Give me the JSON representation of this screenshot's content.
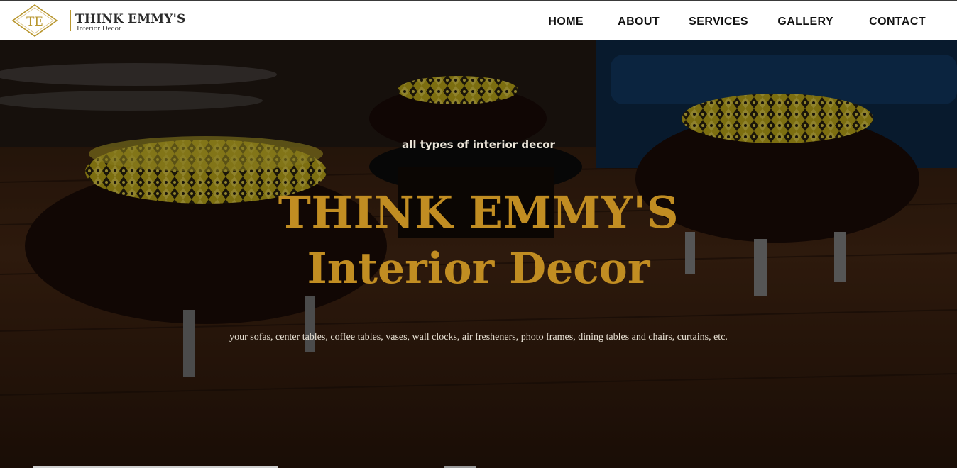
{
  "brand": {
    "monogram": "TE",
    "name": "THINK EMMY'S",
    "subtitle": "Interior Decor",
    "accent_color": "#b8962e"
  },
  "nav": {
    "items": [
      {
        "label": "HOME"
      },
      {
        "label": "ABOUT"
      },
      {
        "label": "SERVICES"
      },
      {
        "label": "GALLERY"
      },
      {
        "label": "CONTACT"
      }
    ]
  },
  "hero": {
    "tagline": "all types of interior decor",
    "title_line1": "THINK EMMY'S",
    "title_line2": "Interior Decor",
    "description": "your sofas, center tables, coffee tables, vases, wall clocks, air fresheners, photo frames, dining tables and chairs, curtains, etc.",
    "title_color": "#c18d22",
    "background_image": "living room with patterned ottomans on wooden floor"
  }
}
